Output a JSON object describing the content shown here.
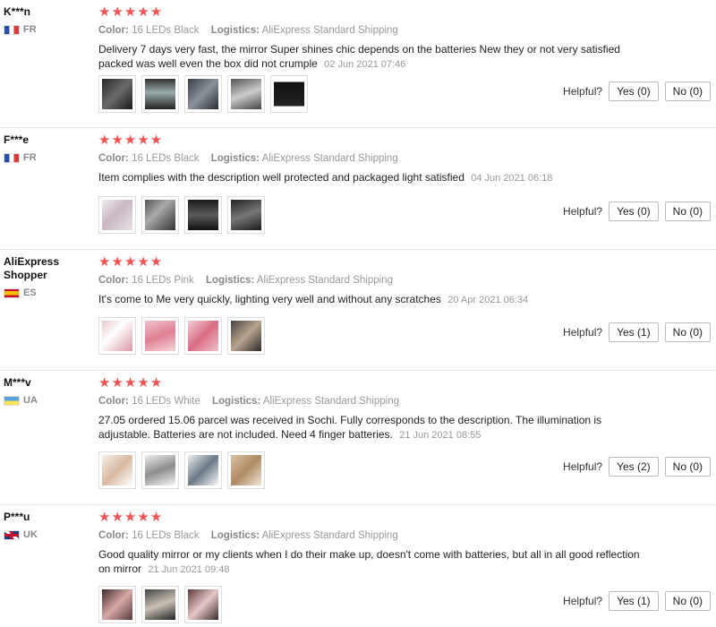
{
  "labels": {
    "color": "Color:",
    "logistics": "Logistics:",
    "helpful": "Helpful?"
  },
  "reviews": [
    {
      "user": "K***n",
      "country": "FR",
      "stars": "★★★★★",
      "color": "16 LEDs Black",
      "logistics": "AliExpress Standard Shipping",
      "text": "Delivery 7 days very fast, the mirror Super shines chic depends on the batteries New they or not very satisfied packed was well even the box did not crumple",
      "date": "02 Jun 2021 07:46",
      "yes": "Yes (0)",
      "no": "No (0)"
    },
    {
      "user": "F***e",
      "country": "FR",
      "stars": "★★★★★",
      "color": "16 LEDs Black",
      "logistics": "AliExpress Standard Shipping",
      "text": "Item complies with the description well protected and packaged light satisfied",
      "date": "04 Jun 2021 06:18",
      "yes": "Yes (0)",
      "no": "No (0)"
    },
    {
      "user": "AliExpress Shopper",
      "country": "ES",
      "stars": "★★★★★",
      "color": "16 LEDs Pink",
      "logistics": "AliExpress Standard Shipping",
      "text": "It's come to Me very quickly, lighting very well and without any scratches",
      "date": "20 Apr 2021 06:34",
      "yes": "Yes (1)",
      "no": "No (0)"
    },
    {
      "user": "M***v",
      "country": "UA",
      "stars": "★★★★★",
      "color": "16 LEDs White",
      "logistics": "AliExpress Standard Shipping",
      "text": "27.05 ordered 15.06 parcel was received in Sochi. Fully corresponds to the description. The illumination is adjustable. Batteries are not included. Need 4 finger batteries.",
      "date": "21 Jun 2021 08:55",
      "yes": "Yes (2)",
      "no": "No (0)"
    },
    {
      "user": "P***u",
      "country": "UK",
      "stars": "★★★★★",
      "color": "16 LEDs Black",
      "logistics": "AliExpress Standard Shipping",
      "text": "Good quality mirror or my clients when I do their make up, doesn't come with batteries, but all in all good reflection on mirror",
      "date": "21 Jun 2021 09:48",
      "yes": "Yes (1)",
      "no": "No (0)"
    }
  ]
}
